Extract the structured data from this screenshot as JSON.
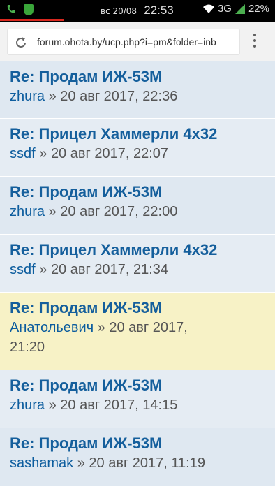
{
  "status_bar": {
    "date": "вс 20/08",
    "time": "22:53",
    "network": "3G",
    "battery": "22%"
  },
  "browser": {
    "url": "forum.ohota.by/ucp.php?i=pm&folder=inb"
  },
  "messages": [
    {
      "title": "Re: Продам ИЖ-53М",
      "author": "zhura",
      "sep": " » ",
      "date": "20 авг 2017, 22:36"
    },
    {
      "title": "Re: Прицел Хаммерли 4х32",
      "author": "ssdf",
      "sep": " » ",
      "date": "20 авг 2017, 22:07"
    },
    {
      "title": "Re: Продам ИЖ-53М",
      "author": "zhura",
      "sep": " » ",
      "date": "20 авг 2017, 22:00"
    },
    {
      "title": "Re: Прицел Хаммерли 4х32",
      "author": "ssdf",
      "sep": " » ",
      "date": "20 авг 2017, 21:34"
    },
    {
      "title": "Re: Продам ИЖ-53М",
      "author": "Анатольевич",
      "sep": " » ",
      "date": "20 авг 2017,",
      "date2": "21:20"
    },
    {
      "title": "Re: Продам ИЖ-53М",
      "author": "zhura",
      "sep": " » ",
      "date": "20 авг 2017, 14:15"
    },
    {
      "title": "Re: Продам ИЖ-53М",
      "author": "sashamak",
      "sep": " » ",
      "date": "20 авг 2017, 11:19"
    }
  ],
  "colors": {
    "read_bg": "#dfe8f1",
    "unread_bg": "#f7f2c6",
    "title": "#155f9c"
  }
}
